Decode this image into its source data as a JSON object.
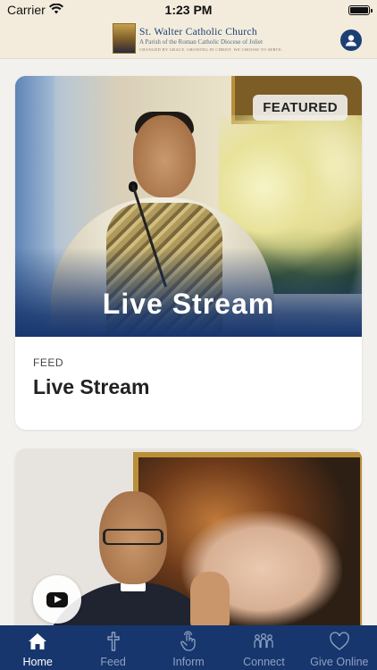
{
  "status_bar": {
    "carrier": "Carrier",
    "time": "1:23 PM",
    "battery_level": 1.0
  },
  "header": {
    "org_name": "St. Walter Catholic Church",
    "org_subtitle": "A Parish of the Roman Catholic Diocese of Joliet",
    "org_motto": "CHANGED BY GRACE. GROWING IN CHRIST. WE CHOOSE TO SERVE.",
    "account_icon": "person-circle-icon"
  },
  "feed": {
    "cards": [
      {
        "badge": "FEATURED",
        "overlay_title": "Live Stream",
        "category": "FEED",
        "title": "Live Stream"
      },
      {
        "media_action_icon": "youtube-play-icon"
      }
    ]
  },
  "tab_bar": {
    "active": "Home",
    "tabs": [
      {
        "label": "Home",
        "icon": "home-icon"
      },
      {
        "label": "Feed",
        "icon": "cross-icon"
      },
      {
        "label": "Inform",
        "icon": "tap-hand-icon"
      },
      {
        "label": "Connect",
        "icon": "people-icon"
      },
      {
        "label": "Give Online",
        "icon": "heart-icon"
      }
    ]
  },
  "colors": {
    "brand_navy": "#17366e",
    "header_cream": "#f3ecdc",
    "background": "#f2f1ee",
    "tab_inactive": "#8fa0bf"
  }
}
